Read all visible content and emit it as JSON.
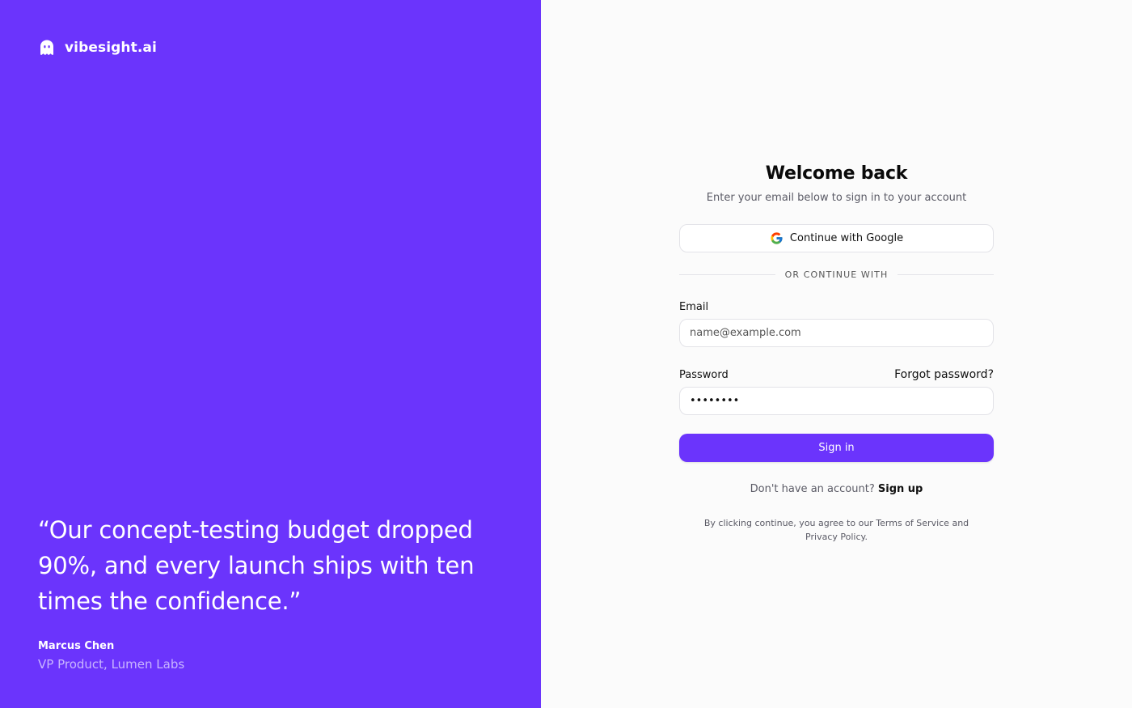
{
  "brand": {
    "name": "vibesight.ai",
    "icon": "ghost-icon"
  },
  "testimonial": {
    "quote": "“Our concept-testing budget dropped 90%, and every launch ships with ten times the confidence.”",
    "author": "Marcus Chen",
    "role": "VP Product, Lumen Labs"
  },
  "form": {
    "title": "Welcome back",
    "subtitle": "Enter your email below to sign in to your account",
    "google_button": "Continue with Google",
    "divider": "OR CONTINUE WITH",
    "email_label": "Email",
    "email_placeholder": "name@example.com",
    "email_value": "",
    "password_label": "Password",
    "forgot_password": "Forgot password?",
    "password_value": "password",
    "signin_button": "Sign in",
    "signup_prompt": "Don't have an account?",
    "signup_link": "Sign up",
    "terms": "By clicking continue, you agree to our Terms of Service and Privacy Policy."
  },
  "colors": {
    "accent": "#6b34fc",
    "background": "#fbfbfb",
    "muted_text": "#5b5b66"
  }
}
